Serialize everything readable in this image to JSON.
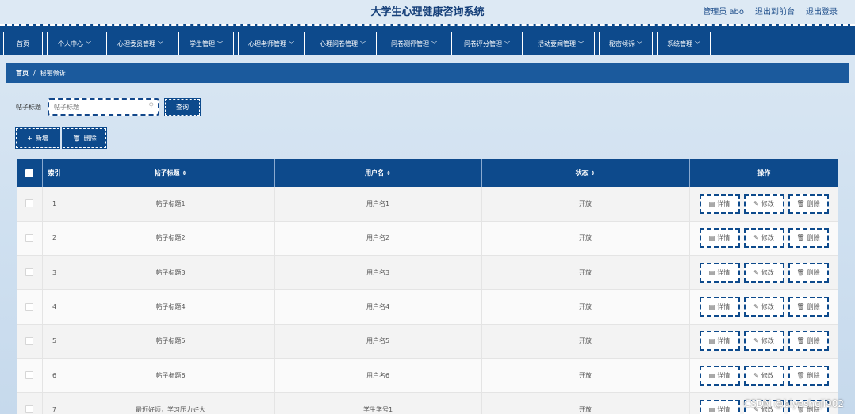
{
  "header": {
    "title": "大学生心理健康咨询系统",
    "user": "管理员 abo",
    "front_link": "退出到前台",
    "logout": "退出登录"
  },
  "nav": [
    {
      "label": "首页",
      "dropdown": false
    },
    {
      "label": "个人中心",
      "dropdown": true
    },
    {
      "label": "心理委员管理",
      "dropdown": true
    },
    {
      "label": "学生管理",
      "dropdown": true
    },
    {
      "label": "心理老师管理",
      "dropdown": true
    },
    {
      "label": "心理问卷管理",
      "dropdown": true
    },
    {
      "label": "问卷测评管理",
      "dropdown": true
    },
    {
      "label": "问卷评分管理",
      "dropdown": true
    },
    {
      "label": "活动要闻管理",
      "dropdown": true
    },
    {
      "label": "秘密倾诉",
      "dropdown": true
    },
    {
      "label": "系统管理",
      "dropdown": true
    }
  ],
  "breadcrumb": {
    "home": "首页",
    "sep": "/",
    "current": "秘密倾诉"
  },
  "search": {
    "label": "帖子标题",
    "placeholder": "帖子标题",
    "button": "查询"
  },
  "actions": {
    "add": "新增",
    "delete": "删除"
  },
  "table": {
    "columns": {
      "index": "索引",
      "title": "帖子标题",
      "username": "用户名",
      "status": "状态",
      "ops": "操作"
    },
    "op_labels": {
      "detail": "详情",
      "edit": "修改",
      "delete": "删除"
    },
    "rows": [
      {
        "index": "1",
        "title": "帖子标题1",
        "username": "用户名1",
        "status": "开放"
      },
      {
        "index": "2",
        "title": "帖子标题2",
        "username": "用户名2",
        "status": "开放"
      },
      {
        "index": "3",
        "title": "帖子标题3",
        "username": "用户名3",
        "status": "开放"
      },
      {
        "index": "4",
        "title": "帖子标题4",
        "username": "用户名4",
        "status": "开放"
      },
      {
        "index": "5",
        "title": "帖子标题5",
        "username": "用户名5",
        "status": "开放"
      },
      {
        "index": "6",
        "title": "帖子标题6",
        "username": "用户名6",
        "status": "开放"
      },
      {
        "index": "7",
        "title": "最近好烦，学习压力好大",
        "username": "学生学号1",
        "status": "开放"
      }
    ]
  },
  "watermark": "CSDN @biyesheji902"
}
